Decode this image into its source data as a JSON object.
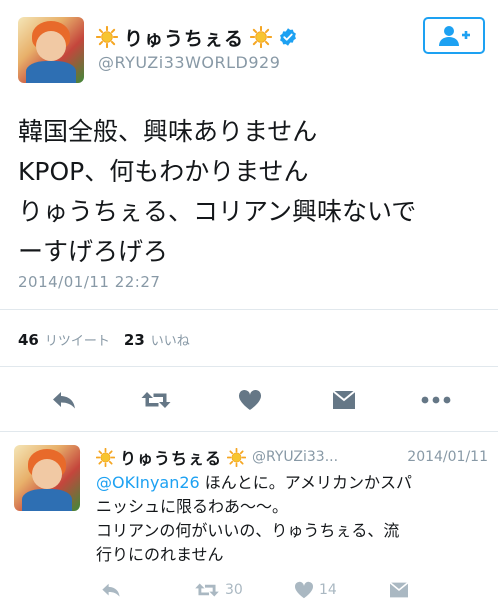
{
  "tweet": {
    "display_name": "りゅうちぇる",
    "handle": "@RYUZi33WORLD929",
    "text_lines": [
      "韓国全般、興味ありません",
      "KPOP、何もわかりません",
      "りゅうちぇる、コリアン興味ないで",
      "ーすげろげろ"
    ],
    "timestamp": "2014/01/11 22:27",
    "retweet_count": "46",
    "retweet_label": "リツイート",
    "like_count": "23",
    "like_label": "いいね"
  },
  "reply": {
    "display_name": "りゅうちぇる",
    "handle": "@RYUZi33...",
    "date": "2014/01/11",
    "mention": "@OKInyan26",
    "text_line1_rest": " ほんとに。アメリカンかスパ",
    "text_lines": [
      "ニッシュに限るわあ〜〜。",
      "コリアンの何がいいの、りゅうちぇる、流",
      "行りにのれません"
    ],
    "retweet_count": "30",
    "like_count": "14"
  },
  "colors": {
    "accent": "#1da1f2",
    "icon_gray": "#657786",
    "light_gray": "#aab8c2",
    "sun": "#f5a623"
  },
  "icons": [
    "sun-icon",
    "verified-badge-icon",
    "follow-person-plus-icon",
    "reply-icon",
    "retweet-icon",
    "heart-icon",
    "message-icon",
    "more-icon"
  ]
}
